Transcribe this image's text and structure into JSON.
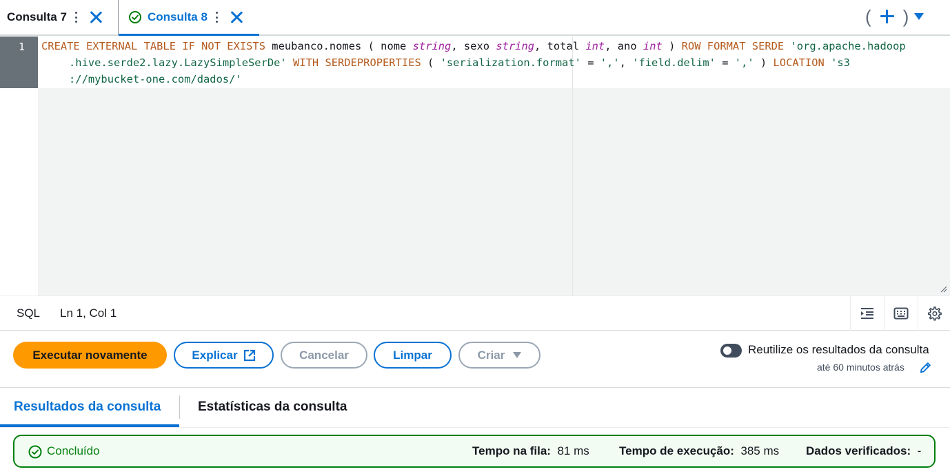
{
  "tabs": [
    {
      "label": "Consulta 7"
    },
    {
      "label": "Consulta 8"
    }
  ],
  "editor": {
    "line_number": "1",
    "code": {
      "line1": [
        {
          "t": "CREATE EXTERNAL TABLE IF NOT EXISTS ",
          "c": "kw"
        },
        {
          "t": "meubanco.nomes ( nome ",
          "c": "ident"
        },
        {
          "t": "string",
          "c": "typ"
        },
        {
          "t": ", sexo ",
          "c": "ident"
        },
        {
          "t": "string",
          "c": "typ"
        },
        {
          "t": ", total ",
          "c": "ident"
        },
        {
          "t": "int",
          "c": "typ"
        },
        {
          "t": ", ano ",
          "c": "ident"
        },
        {
          "t": "int",
          "c": "typ"
        },
        {
          "t": " ) ",
          "c": "ident"
        },
        {
          "t": "ROW FORMAT SERDE ",
          "c": "kw"
        },
        {
          "t": "'org.apache.hadoop",
          "c": "str"
        }
      ],
      "line2": [
        {
          "t": ".hive.serde2.lazy.LazySimpleSerDe'",
          "c": "str"
        },
        {
          "t": " WITH SERDEPROPERTIES ",
          "c": "kw"
        },
        {
          "t": "( ",
          "c": "ident"
        },
        {
          "t": "'serialization.format'",
          "c": "str"
        },
        {
          "t": " = ",
          "c": "ident"
        },
        {
          "t": "','",
          "c": "str"
        },
        {
          "t": ", ",
          "c": "ident"
        },
        {
          "t": "'field.delim'",
          "c": "str"
        },
        {
          "t": " = ",
          "c": "ident"
        },
        {
          "t": "','",
          "c": "str"
        },
        {
          "t": " ) ",
          "c": "ident"
        },
        {
          "t": "LOCATION ",
          "c": "kw"
        },
        {
          "t": "'s3",
          "c": "str"
        }
      ],
      "line3": [
        {
          "t": "://mybucket-one.com/dados/'",
          "c": "str"
        }
      ]
    }
  },
  "statusbar": {
    "language": "SQL",
    "cursor": "Ln 1, Col 1"
  },
  "actions": {
    "run_again": "Executar novamente",
    "explain": "Explicar",
    "cancel": "Cancelar",
    "clear": "Limpar",
    "create": "Criar",
    "reuse_label": "Reutilize os resultados da consulta",
    "reuse_sub": "até 60 minutos atrás",
    "reuse_enabled": false
  },
  "results": {
    "tab_results": "Resultados da consulta",
    "tab_stats": "Estatísticas da consulta",
    "status": "Concluído",
    "queue_label": "Tempo na fila:",
    "queue_value": "81 ms",
    "exec_label": "Tempo de execução:",
    "exec_value": "385 ms",
    "scanned_label": "Dados verificados:",
    "scanned_value": "-"
  },
  "colors": {
    "accent": "#0972d3",
    "primary_button": "#ff9900",
    "success": "#037f0c"
  }
}
